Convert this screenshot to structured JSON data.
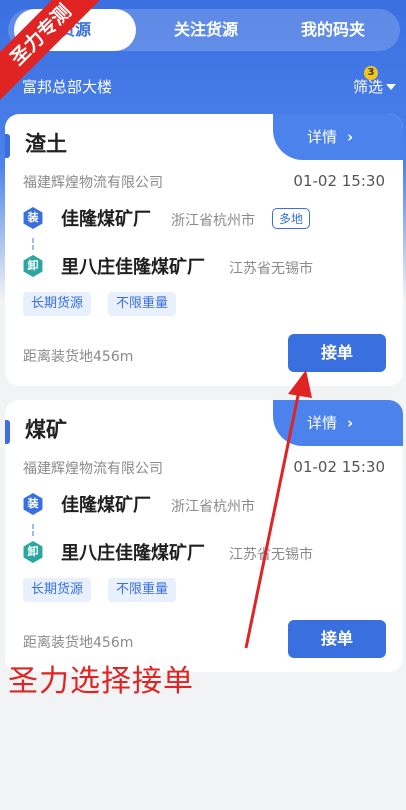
{
  "tabs": [
    {
      "label": "货源",
      "active": true
    },
    {
      "label": "关注货源",
      "active": false
    },
    {
      "label": "我的码夹",
      "active": false
    }
  ],
  "location": "富邦总部大楼",
  "filter": {
    "label": "筛选",
    "badge": "3"
  },
  "cards": [
    {
      "title": "渣土",
      "details_label": "详情",
      "company": "福建辉煌物流有限公司",
      "time": "01-02 15:30",
      "load": {
        "icon_label": "装",
        "name": "佳隆煤矿厂",
        "region": "浙江省杭州市",
        "tag": "多地"
      },
      "unload": {
        "icon_label": "卸",
        "name": "里八庄佳隆煤矿厂",
        "region": "江苏省无锡市"
      },
      "tags": [
        "长期货源",
        "不限重量"
      ],
      "distance": "距离装货地456m",
      "action_label": "接单"
    },
    {
      "title": "煤矿",
      "details_label": "详情",
      "company": "福建辉煌物流有限公司",
      "time": "01-02 15:30",
      "load": {
        "icon_label": "装",
        "name": "佳隆煤矿厂",
        "region": "浙江省杭州市",
        "tag": ""
      },
      "unload": {
        "icon_label": "卸",
        "name": "里八庄佳隆煤矿厂",
        "region": "江苏省无锡市"
      },
      "tags": [
        "长期货源",
        "不限重量"
      ],
      "distance": "距离装货地456m",
      "action_label": "接单"
    }
  ],
  "watermark": {
    "corner": "圣力专测",
    "caption": "圣力选择接单"
  },
  "colors": {
    "primary": "#3a6fe0",
    "unload": "#2aa7a0",
    "annotation": "#e02424"
  }
}
